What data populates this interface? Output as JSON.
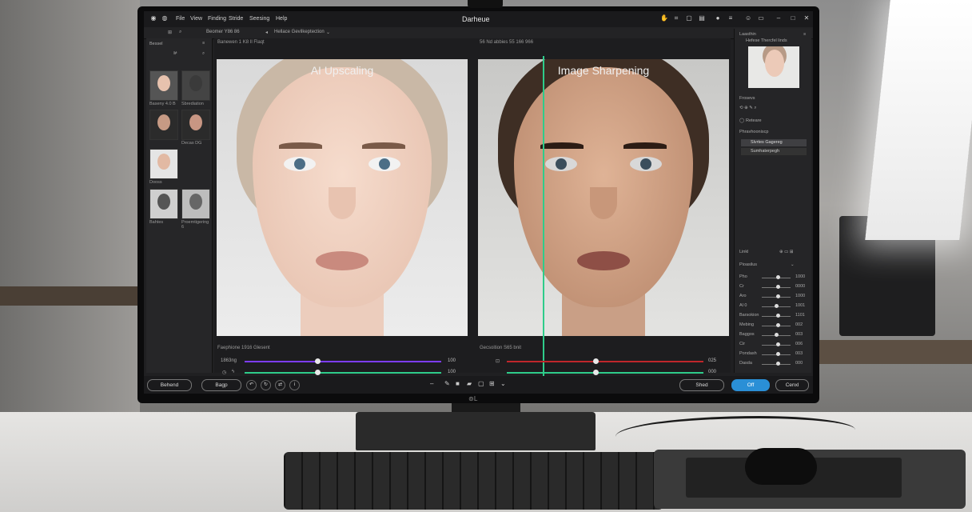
{
  "window": {
    "title": "Darheue"
  },
  "menu": [
    "File",
    "View",
    "Finding",
    "Stride",
    "Seesing",
    "Help"
  ],
  "toolbar": {
    "left_text": "Beomer Y86  86",
    "right_text": "Hellace Gevilkeptection"
  },
  "left_panel": {
    "title": "Bessel",
    "thumbnails": [
      {
        "label": "Baseny 4.0 B"
      },
      {
        "label": "Sbrediation"
      },
      {
        "label": ""
      },
      {
        "label": "Decas   DG"
      },
      {
        "label": "Dooss"
      },
      {
        "label": "Bahtes"
      },
      {
        "label": "Proemtigering 6"
      }
    ]
  },
  "viewer": {
    "left_header": "Banewen 1 K8  Il Flaqt",
    "right_header": "56 Nd abbies   55  166 966",
    "left_title": "AI Upscaling",
    "right_title": "Image Sharpening",
    "left_footer": "Faephione    1916  Glesent",
    "right_footer": "Gecsoition    S65  bnit",
    "sliders_left": [
      {
        "label": "1863ng",
        "value": "100",
        "level": 0.37,
        "color": "#7d3cff"
      },
      {
        "label": "",
        "value": "100",
        "level": 0.37,
        "color": "#2ecc8a"
      }
    ],
    "sliders_right": [
      {
        "label": "",
        "value": "025",
        "level": 0.45,
        "color": "#c0262b"
      },
      {
        "label": "",
        "value": "000",
        "level": 0.45,
        "color": "#2ecc8a"
      }
    ]
  },
  "right_panel": {
    "header": "Laasthin",
    "subheader": "Hefese Thercfel linds",
    "properties": "Frosevs",
    "layers_title": "Reteare",
    "layer_group": "Phravhooniscp",
    "layers": [
      "Slvrtes Gagereg",
      "Sumhaterpegh"
    ],
    "adjust_header": "Linkl",
    "adjust_sub": "Pioasilus",
    "adjustments": [
      {
        "label": "Pho",
        "value": "1000",
        "level": 0.55
      },
      {
        "label": "Cr",
        "value": "0000",
        "level": 0.55
      },
      {
        "label": "Aro",
        "value": "1000",
        "level": 0.55
      },
      {
        "label": "Al 0",
        "value": "1001",
        "level": 0.5
      },
      {
        "label": "Barsokion",
        "value": "1101",
        "level": 0.55
      },
      {
        "label": "Mebing",
        "value": "002",
        "level": 0.55
      },
      {
        "label": "Baggos",
        "value": "003",
        "level": 0.5
      },
      {
        "label": "Cir",
        "value": "006",
        "level": 0.55
      },
      {
        "label": "Pondash",
        "value": "003",
        "level": 0.55
      },
      {
        "label": "Dasda",
        "value": "000",
        "level": 0.55
      }
    ]
  },
  "bottom_bar": {
    "btn_left1": "Behend",
    "btn_left2": "Bagp",
    "btn_save": "Shed",
    "btn_ok": "Off",
    "btn_cancel": "Cenxl"
  },
  "monitor_brand": "⊚L",
  "colors": {
    "accent": "#2ecc8a",
    "primary": "#2a8fd6"
  }
}
